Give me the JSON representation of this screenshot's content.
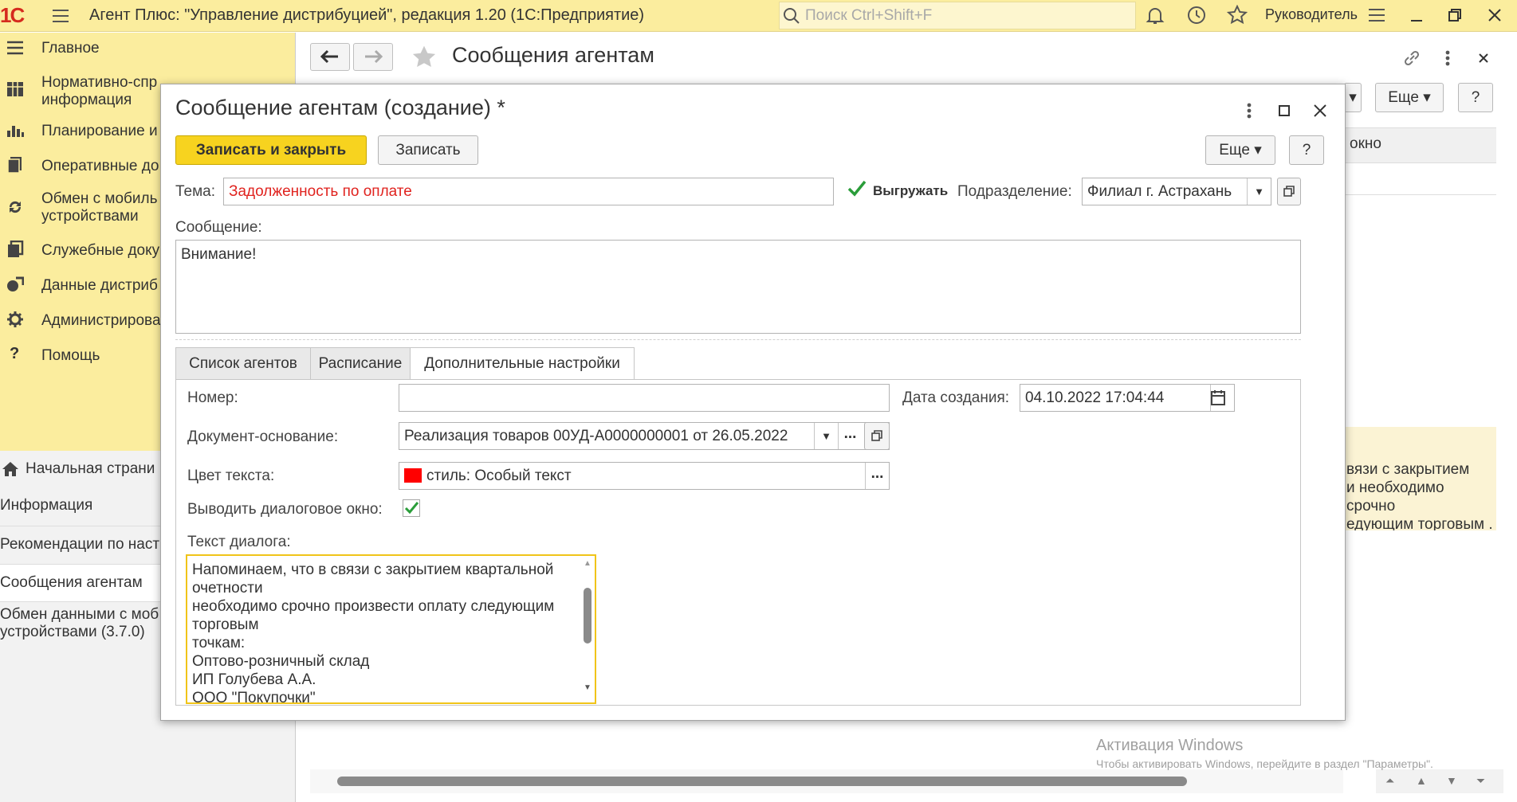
{
  "app": {
    "logo": "1С",
    "title": "Агент Плюс: \"Управление дистрибуцией\", редакция 1.20  (1С:Предприятие)",
    "search_placeholder": "Поиск Ctrl+Shift+F",
    "user": "Руководитель"
  },
  "sidebar": {
    "sections": [
      {
        "label": "Главное",
        "icon": "menu-icon"
      },
      {
        "label": "Нормативно-спр\nинформация",
        "icon": "grid-icon"
      },
      {
        "label": "Планирование и",
        "icon": "bar-chart-icon"
      },
      {
        "label": "Оперативные до",
        "icon": "documents-icon"
      },
      {
        "label": "Обмен с мобиль\nустройствами",
        "icon": "sync-icon"
      },
      {
        "label": "Служебные доку",
        "icon": "copy-icon"
      },
      {
        "label": "Данные дистриб",
        "icon": "data-icon"
      },
      {
        "label": "Администрирова",
        "icon": "gear-icon"
      },
      {
        "label": "Помощь",
        "icon": "help-icon"
      }
    ],
    "nav": [
      {
        "label": "Начальная страни"
      },
      {
        "label": "Информация"
      },
      {
        "label": "Рекомендации по наст"
      },
      {
        "label": "Сообщения агентам"
      },
      {
        "label": "Обмен данными с моб\nустройствами (3.7.0)"
      }
    ]
  },
  "main": {
    "title": "Сообщения агентам",
    "more_label": "Еще",
    "help_label": "?",
    "list_header": "окно",
    "list_snippet": "вязи с закрытием\nи необходимо срочно\nедующим торговым ."
  },
  "modal": {
    "title": "Сообщение агентам (создание) *",
    "save_close_label": "Записать и закрыть",
    "save_label": "Записать",
    "more_label": "Еще",
    "help_label": "?",
    "topic_label": "Тема:",
    "topic_value": "Задолженность по оплате",
    "unload_label": "Выгружать",
    "unload_checked": true,
    "division_label": "Подразделение:",
    "division_value": "Филиал г. Астрахань",
    "message_label": "Сообщение:",
    "message_value": "Внимание!",
    "tabs": [
      "Список агентов",
      "Расписание",
      "Дополнительные настройки"
    ],
    "active_tab": "Дополнительные настройки",
    "number_label": "Номер:",
    "number_value": "",
    "created_label": "Дата создания:",
    "created_value": "04.10.2022 17:04:44",
    "basis_label": "Документ-основание:",
    "basis_value": "Реализация товаров 00УД-А0000000001 от 26.05.2022",
    "color_label": "Цвет текста:",
    "color_value": "стиль: Особый текст",
    "color_swatch": "#ff0000",
    "dialog_show_label": "Выводить диалоговое окно:",
    "dialog_show_checked": true,
    "dialog_text_label": "Текст диалога:",
    "dialog_text": "Напоминаем, что в связи с закрытием квартальной очетности\nнеобходимо срочно произвести оплату следующим торговым\nточкам:\nОптово-розничный склад\nИП Голубева А.А.\nООО \"Покупочки\"\nМясная лавка\nООО \"Агроторг\""
  },
  "watermark": {
    "line1": "Активация Windows",
    "line2": "Чтобы активировать Windows, перейдите в раздел \"Параметры\"."
  },
  "colors": {
    "accent_yellow": "#fbed9e",
    "primary_button": "#f7d31f",
    "check_green": "#2a9d3a",
    "topic_red": "#e0231f"
  }
}
